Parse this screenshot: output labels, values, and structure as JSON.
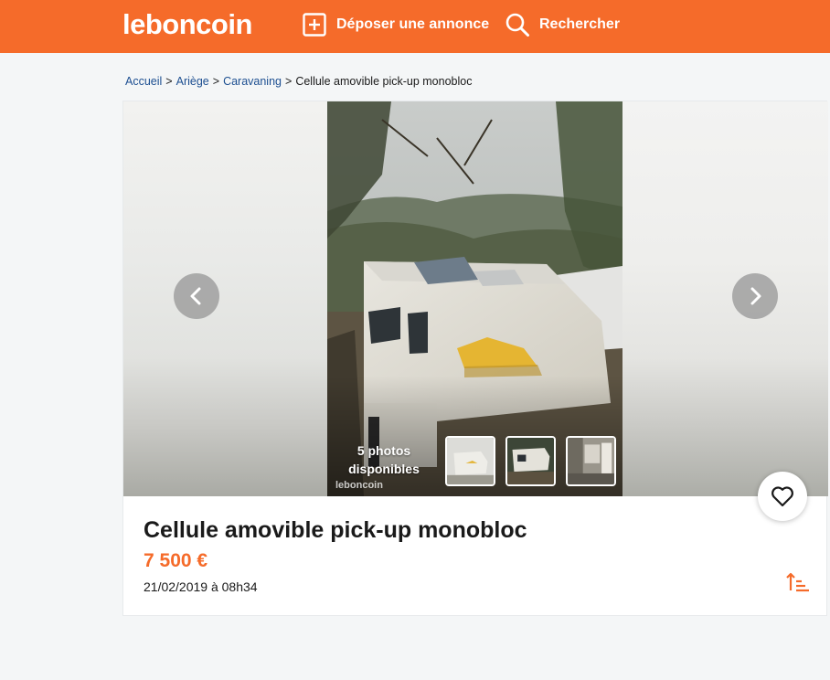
{
  "header": {
    "logo": "leboncoin",
    "deposit_label": "Déposer une annonce",
    "search_label": "Rechercher",
    "brand_color": "#f56b2a"
  },
  "breadcrumb": {
    "items": [
      "Accueil",
      "Ariège",
      "Caravaning"
    ],
    "separator": ">",
    "current": "Cellule amovible pick-up monobloc"
  },
  "gallery": {
    "photos_label": "5 photos disponibles",
    "watermark": "leboncoin",
    "thumbnail_count": 3
  },
  "listing": {
    "title": "Cellule amovible pick-up monobloc",
    "price": "7 500 €",
    "date": "21/02/2019 à 08h34",
    "accent_color": "#f56b2a"
  },
  "icons": [
    "plus-square-icon",
    "search-icon",
    "chevron-left-icon",
    "chevron-right-icon",
    "heart-icon",
    "sort-icon"
  ]
}
